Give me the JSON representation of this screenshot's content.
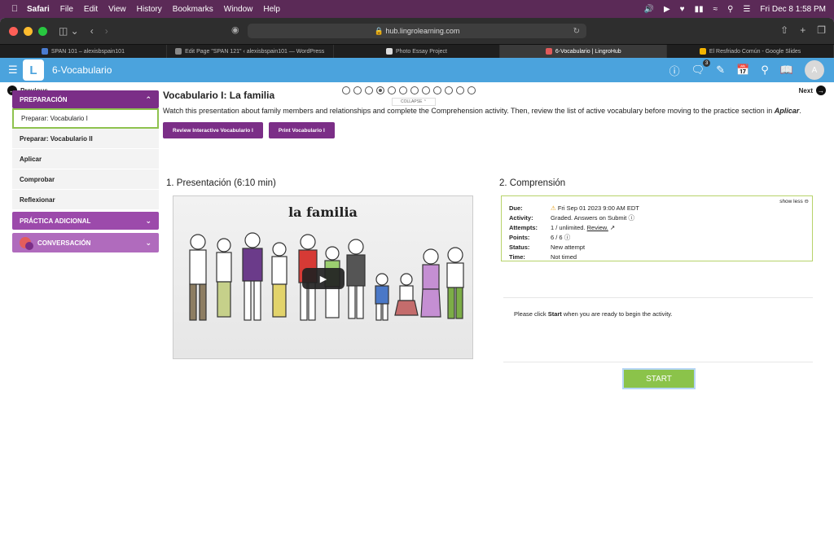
{
  "menubar": {
    "app": "Safari",
    "items": [
      "File",
      "Edit",
      "View",
      "History",
      "Bookmarks",
      "Window",
      "Help"
    ],
    "datetime": "Fri Dec 8  1:58 PM"
  },
  "browser": {
    "url": "hub.lingrolearning.com",
    "tabs": [
      {
        "label": "SPAN 101 – alexisbspain101",
        "color": "#4a7bd0"
      },
      {
        "label": "Edit Page \"SPAN 121\" ‹ alexisbspain101 — WordPress",
        "color": "#888888"
      },
      {
        "label": "Photo Essay Project",
        "color": "#dddddd"
      },
      {
        "label": "6-Vocabulario | LingroHub",
        "color": "#e05a5a"
      },
      {
        "label": "El Resfriado Común - Google Slides",
        "color": "#f4b400"
      }
    ],
    "active_tab": 3
  },
  "app": {
    "logo_letter": "L",
    "title": "6-Vocabulario",
    "badge_count": "3",
    "avatar_initial": "A"
  },
  "pager": {
    "prev_label": "Previous",
    "next_label": "Next",
    "page_count": 12,
    "active_page": 4,
    "collapse_label": "COLLAPSE"
  },
  "sidebar": {
    "section1": "PREPARACIÓN",
    "items": [
      "Preparar: Vocabulario I",
      "Preparar: Vocabulario II",
      "Aplicar",
      "Comprobar",
      "Reflexionar"
    ],
    "section2": "PRÁCTICA ADICIONAL",
    "section3": "CONVERSACIÓN"
  },
  "main": {
    "title": "Vocabulario I: La familia",
    "intro": "Watch this presentation about family members and relationships and complete the Comprehension activity. Then, review the list of active vocabulary before moving to the practice section in ",
    "intro_em": "Aplicar",
    "intro_end": ".",
    "btn_review": "Review Interactive Vocabulario I",
    "btn_print": "Print Vocabulario I",
    "col1_title": "1. Presentación (6:10 min)",
    "col2_title": "2. Comprensión",
    "video_title": "la familia"
  },
  "activity": {
    "show_less": "show less",
    "due_label": "Due:",
    "due_value": "Fri Sep 01 2023 9:00 AM EDT",
    "activity_label": "Activity:",
    "activity_value": "Graded. Answers on Submit",
    "attempts_label": "Attempts:",
    "attempts_value": "1 / unlimited.",
    "attempts_review": "Review.",
    "points_label": "Points:",
    "points_value": "6 / 6",
    "status_label": "Status:",
    "status_value": "New attempt",
    "time_label": "Time:",
    "time_value": "Not timed",
    "instruction_pre": "Please click ",
    "instruction_strong": "Start",
    "instruction_post": " when you are ready to begin the activity.",
    "start_label": "START"
  },
  "colors": {
    "purple": "#7b2e87",
    "blue": "#4ba3dd",
    "green": "#8bc34a"
  }
}
